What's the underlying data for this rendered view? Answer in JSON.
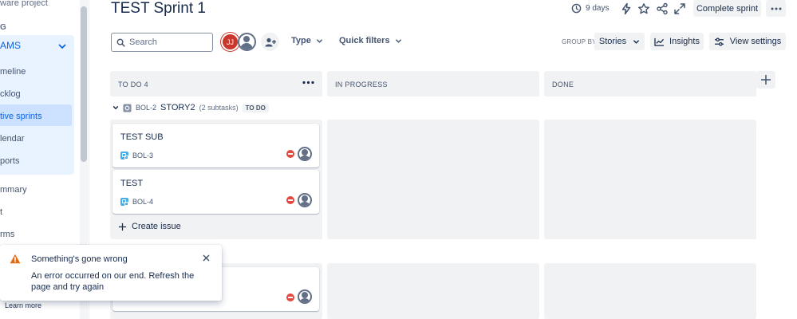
{
  "sidebar": {
    "project_type": "ware project",
    "section_label": "G",
    "group_label": "AMS",
    "items": [
      {
        "label": "meline"
      },
      {
        "label": "cklog"
      },
      {
        "label": "tive sprints"
      },
      {
        "label": "lendar"
      },
      {
        "label": "ports"
      },
      {
        "label": "mmary"
      },
      {
        "label": "t"
      },
      {
        "label": "rms"
      }
    ]
  },
  "header": {
    "title": "TEST Sprint 1",
    "days_remaining": "9 days",
    "complete_label": "Complete sprint"
  },
  "toolbar": {
    "search_placeholder": "Search",
    "avatar_initials": "JJ",
    "type_label": "Type",
    "quick_filters_label": "Quick filters",
    "group_by_label": "GROUP BY",
    "group_by_value": "Stories",
    "insights_label": "Insights",
    "view_settings_label": "View settings"
  },
  "columns": [
    {
      "label": "TO DO 4"
    },
    {
      "label": "IN PROGRESS"
    },
    {
      "label": "DONE"
    }
  ],
  "swimlane": {
    "key": "BOL-2",
    "name": "STORY2",
    "subtasks": "(2 subtasks)",
    "status": "TO DO"
  },
  "cards": [
    {
      "title": "TEST SUB",
      "key": "BOL-3"
    },
    {
      "title": "TEST",
      "key": "BOL-4"
    }
  ],
  "create_issue_label": "Create issue",
  "toast": {
    "title": "Something's gone wrong",
    "message": "An error occurred on our end. Refresh the page and try again"
  },
  "learn_more_label": "Learn more",
  "colors": {
    "accent": "#0c66e4",
    "error": "#e2483d",
    "warning": "#e56910",
    "column_bg": "#f1f2f4"
  }
}
